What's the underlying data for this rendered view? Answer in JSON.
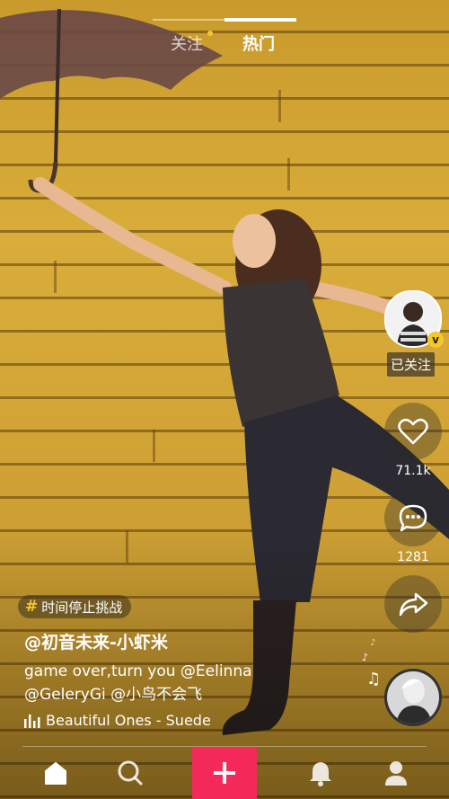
{
  "tabs": {
    "follow_label": "关注",
    "hot_label": "热门",
    "active": "热门"
  },
  "creator": {
    "follow_status": "已关注",
    "verified_badge": "v"
  },
  "actions": {
    "likes": "71.1k",
    "comments": "1281"
  },
  "post": {
    "challenge_tag": "时间停止挑战",
    "author": "@初音未来-小虾米",
    "caption_line1": "game over,turn you @Eelinna",
    "caption_line2": "@GeleryGi @小鸟不会飞",
    "music": "Beautiful Ones - Suede"
  },
  "bottom_nav": {
    "add_label": "+"
  },
  "colors": {
    "accent_pink": "#f6295b",
    "accent_yellow": "#f5c82a"
  },
  "icons": [
    "home-icon",
    "search-icon",
    "add-icon",
    "bell-icon",
    "profile-icon",
    "heart-icon",
    "comment-icon",
    "share-icon",
    "music-note-icon",
    "music-bars-icon",
    "umbrella-illustration"
  ]
}
